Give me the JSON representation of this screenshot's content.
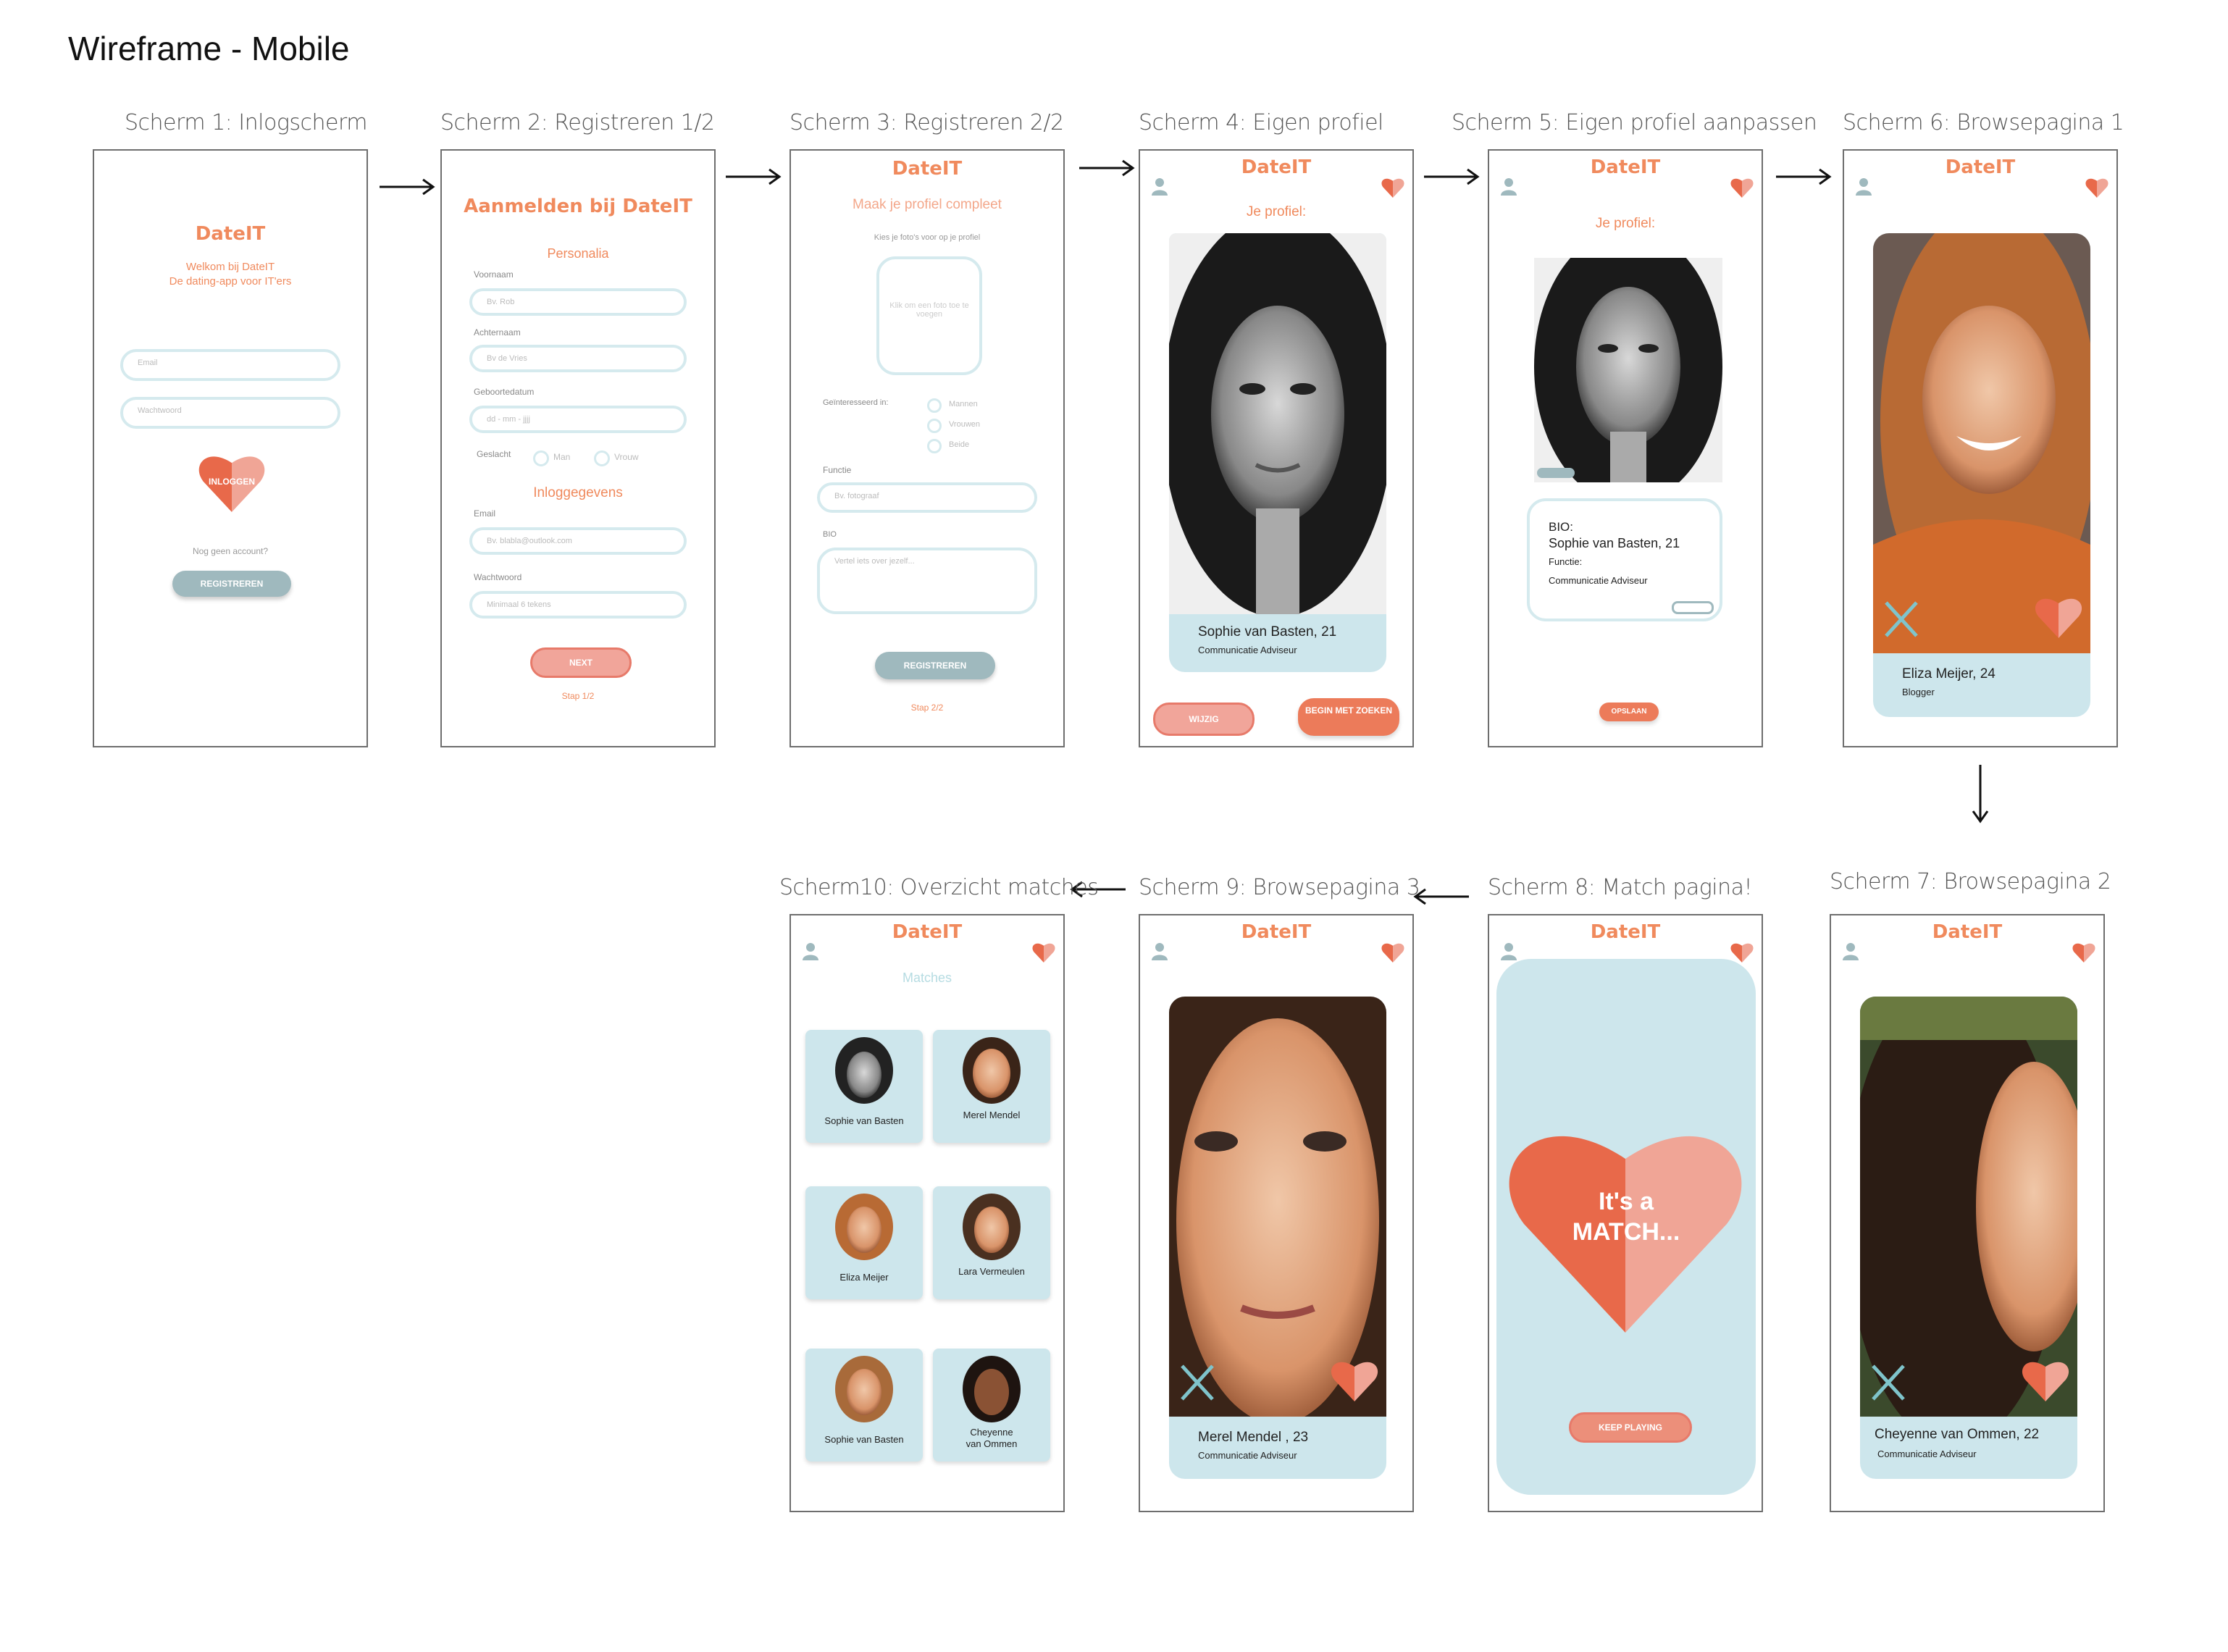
{
  "page_title": "Wireframe - Mobile",
  "brand": "DateIT",
  "colors": {
    "brand": "#f08a5d",
    "card_bg": "#cde6ec",
    "heart_dark": "#e8694a",
    "heart_light": "#f0a596",
    "gray_button": "#9fb9be"
  },
  "screens": {
    "s1": {
      "title": "Scherm 1: Inlogscherm",
      "welcome": "Welkom bij DateIT",
      "tagline": "De dating-app voor IT'ers",
      "email_ph": "Email",
      "password_ph": "Wachtwoord",
      "login": "INLOGGEN",
      "no_account": "Nog geen account?",
      "register": "REGISTREREN"
    },
    "s2": {
      "title": "Scherm 2: Registreren 1/2",
      "heading": "Aanmelden bij DateIT",
      "section1": "Personalia",
      "firstname_label": "Voornaam",
      "firstname_ph": "Bv. Rob",
      "lastname_label": "Achternaam",
      "lastname_ph": "Bv de Vries",
      "dob_label": "Geboortedatum",
      "dob_ph": "dd - mm - jjjj",
      "gender_label": "Geslacht",
      "gender_m": "Man",
      "gender_f": "Vrouw",
      "section2": "Inloggegevens",
      "email_label": "Email",
      "email_ph": "Bv. blabla@outlook.com",
      "password_label": "Wachtwoord",
      "password_ph": "Minimaal 6 tekens",
      "next": "NEXT",
      "step": "Stap 1/2"
    },
    "s3": {
      "title": "Scherm 3: Registreren 2/2",
      "heading": "Maak je profiel compleet",
      "photo_hint": "Kies je foto's voor op je profiel",
      "photo_box": "Klik om een foto toe te voegen",
      "interest_label": "Geïnteresseerd in:",
      "opt1": "Mannen",
      "opt2": "Vrouwen",
      "opt3": "Beide",
      "function_label": "Functie",
      "function_ph": "Bv. fotograaf",
      "bio_label": "BIO",
      "bio_ph": "Vertel iets over jezelf...",
      "register": "REGISTREREN",
      "step": "Stap 2/2"
    },
    "s4": {
      "title": "Scherm 4: Eigen profiel",
      "heading": "Je profiel:",
      "name": "Sophie van Basten, 21",
      "role": "Communicatie Adviseur",
      "edit": "WIJZIG",
      "search": "BEGIN MET ZOEKEN"
    },
    "s5": {
      "title": "Scherm 5: Eigen profiel aanpassen",
      "heading": "Je profiel:",
      "bio_label": "BIO:",
      "name": "Sophie van Basten, 21",
      "function_label": "Functie:",
      "role": "Communicatie Adviseur",
      "save": "OPSLAAN"
    },
    "s6": {
      "title": "Scherm 6: Browsepagina 1",
      "name": "Eliza Meijer, 24",
      "role": "Blogger"
    },
    "s7": {
      "title": "Scherm 7: Browsepagina 2",
      "name": "Cheyenne van Ommen, 22",
      "role": "Communicatie Adviseur"
    },
    "s8": {
      "title": "Scherm 8: Match pagina!",
      "match_line1": "It's a",
      "match_line2": "MATCH...",
      "keep": "KEEP PLAYING"
    },
    "s9": {
      "title": "Scherm 9: Browsepagina 3",
      "name": "Merel Mendel , 23",
      "role": "Communicatie Adviseur"
    },
    "s10": {
      "title": "Scherm10: Overzicht matches",
      "heading": "Matches",
      "matches": [
        {
          "name": "Sophie van Basten"
        },
        {
          "name": "Merel Mendel"
        },
        {
          "name": "Eliza Meijer"
        },
        {
          "name": "Lara Vermeulen"
        },
        {
          "name": "Sophie van Basten"
        },
        {
          "name": "Cheyenne van Ommen"
        }
      ]
    }
  }
}
